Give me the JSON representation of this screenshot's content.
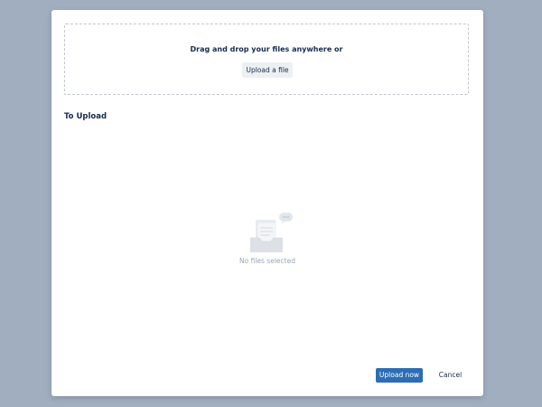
{
  "dropzone": {
    "prompt": "Drag and drop your files anywhere or",
    "upload_button_label": "Upload a file"
  },
  "to_upload": {
    "title": "To Upload",
    "empty_message": "No files selected",
    "empty_icon": "empty-inbox-illustration"
  },
  "footer": {
    "upload_now_label": "Upload now",
    "cancel_label": "Cancel"
  },
  "colors": {
    "backdrop": "#a1aebf",
    "primary": "#2c6db3",
    "text": "#172b4d",
    "muted_text": "#9aa5b8"
  }
}
